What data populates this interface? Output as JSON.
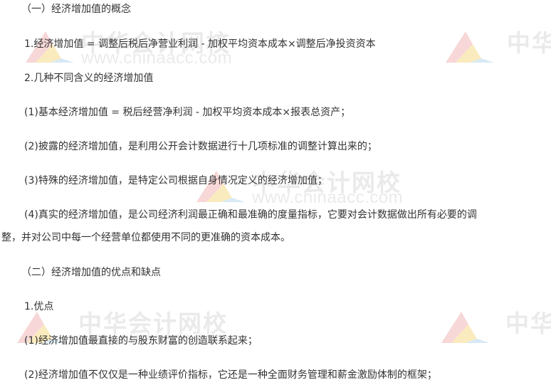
{
  "watermark": {
    "brand_cn": "中华会计网校",
    "brand_cn_partial": "中华",
    "url": "www.chinaacc.com",
    "logo_colors": [
      "#f2b8b8",
      "#f7dc8a",
      "#b9d8ef"
    ]
  },
  "document": {
    "lines": [
      "（一）经济增加值的概念",
      "1.经济增加值 = 调整后税后净营业利润 - 加权平均资本成本×调整后净投资资本",
      "2.几种不同含义的经济增加值",
      "(1)基本经济增加值 = 税后经营净利润 - 加权平均资本成本×报表总资产；",
      "(2)披露的经济增加值，是利用公开会计数据进行十几项标准的调整计算出来的；",
      "(3)特殊的经济增加值，是特定公司根据自身情况定义的经济增加值；",
      "(4)真实的经济增加值，是公司经济利润最正确和最准确的度量指标，它要对会计数据做出所有必要的调",
      "整，并对公司中每一个经营单位都使用不同的更准确的资本成本。",
      "（二）经济增加值的优点和缺点",
      "1.优点",
      "(1)经济增加值最直接的与股东财富的创造联系起来；",
      "(2)经济增加值不仅仅是一种业绩评价指标，它还是一种全面财务管理和薪金激励体制的框架；"
    ]
  }
}
